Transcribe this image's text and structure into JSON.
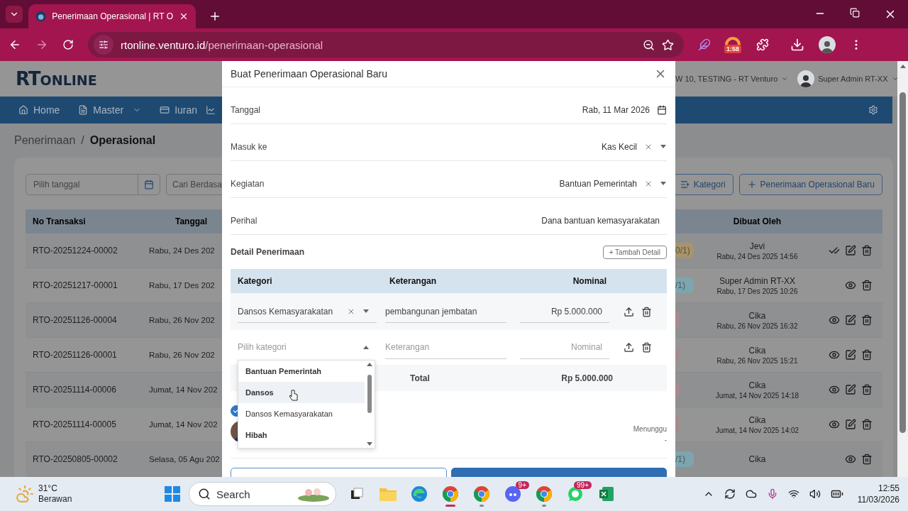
{
  "browser": {
    "tab_title": "Penerimaan Operasional | RT O",
    "url_host": "rtonline.venturo.id",
    "url_path": "/penerimaan-operasional",
    "extension_badge": "1:58"
  },
  "app": {
    "logo": {
      "first": "RT",
      "second": "ONLINE"
    },
    "org": "W 10, TESTING - RT Venturo",
    "user": "Super Admin RT-XX",
    "nav": [
      {
        "label": "Home",
        "kind": "home",
        "dropdown": false
      },
      {
        "label": "Master",
        "kind": "file",
        "dropdown": true
      },
      {
        "label": "Iuran",
        "kind": "card",
        "dropdown": false
      }
    ],
    "breadcrumb": {
      "parent": "Penerimaan",
      "separator": "/",
      "current": "Operasional"
    },
    "filters": {
      "date_placeholder": "Pilih tanggal",
      "search_placeholder": "Cari Berdasa"
    },
    "buttons": [
      {
        "label": "Kategori",
        "kind": "list"
      },
      {
        "label": "Penerimaan Operasional Baru",
        "kind": "plus"
      }
    ],
    "table": {
      "columns": [
        "No Transaksi",
        "Tanggal",
        "Dibuat Oleh"
      ],
      "rows": [
        {
          "no": "RTO-20251224-00002",
          "date": "Rabu, 24 Des 202",
          "badge": "0/1)",
          "color": "#a8946c",
          "by": "Jevi",
          "by_date": "Rabu, 24 Des 2025 14:56",
          "actions": [
            {
              "kind": "approve"
            },
            {
              "kind": "edit"
            },
            {
              "kind": "delete"
            }
          ]
        },
        {
          "no": "RTO-20251217-00001",
          "date": "Rabu, 17 Des 202",
          "badge": "/1)",
          "color": "#7ea5ae",
          "by": "Super Admin RT-XX",
          "by_date": "Rabu, 17 Des 2025 10:26",
          "actions": [
            {
              "kind": "view"
            },
            {
              "kind": "delete"
            }
          ]
        },
        {
          "no": "RTO-20251126-00004",
          "date": "Rabu, 26 Nov 202",
          "color": "#a88a8c",
          "by": "Cika",
          "by_date": "Rabu, 26 Nov 2025 16:32",
          "actions": [
            {
              "kind": "view"
            },
            {
              "kind": "edit"
            },
            {
              "kind": "delete"
            }
          ]
        },
        {
          "no": "RTO-20251126-00001",
          "date": "Rabu, 26 Nov 202",
          "color": "#a88a8c",
          "by": "Cika",
          "by_date": "Rabu, 26 Nov 2025 15:21",
          "actions": [
            {
              "kind": "view"
            },
            {
              "kind": "edit"
            },
            {
              "kind": "delete"
            }
          ]
        },
        {
          "no": "RTO-20251114-00006",
          "date": "Jumat, 14 Nov 202",
          "color": "#a88a8c",
          "by": "Cika",
          "by_date": "Jumat, 14 Nov 2025 14:18",
          "actions": [
            {
              "kind": "view"
            },
            {
              "kind": "edit"
            },
            {
              "kind": "delete"
            }
          ]
        },
        {
          "no": "RTO-20251114-00005",
          "date": "Jumat, 14 Nov 202",
          "color": "#a88a8c",
          "by": "Cika",
          "by_date": "Jumat, 14 Nov 2025 14:02",
          "actions": [
            {
              "kind": "view"
            },
            {
              "kind": "edit"
            },
            {
              "kind": "delete"
            }
          ]
        },
        {
          "no": "RTO-20250805-00002",
          "date": "Selasa, 05 Agu 202",
          "badge": "/1)",
          "color": "#7ea5ae",
          "by": "Cika",
          "actions": [
            {
              "kind": "view"
            },
            {
              "kind": "delete"
            }
          ]
        }
      ]
    }
  },
  "modal": {
    "title": "Buat Penerimaan Operasional Baru",
    "fields": [
      {
        "label": "Tanggal",
        "value": "Rab, 11 Mar 2026",
        "kind": "date"
      },
      {
        "label": "Masuk ke",
        "value": "Kas Kecil",
        "kind": "select"
      },
      {
        "label": "Kegiatan",
        "value": "Bantuan Pemerintah",
        "kind": "select"
      },
      {
        "label": "Perihal",
        "value": "Dana bantuan kemasyarakatan",
        "kind": "text"
      }
    ],
    "detail_title": "Detail Penerimaan",
    "add_button": "+ Tambah Detail",
    "columns": [
      "Kategori",
      "Keterangan",
      "Nominal"
    ],
    "rows": [
      {
        "kategori": "Dansos Kemasyarakatan",
        "keterangan": "pembangunan jembatan",
        "nominal": "Rp 5.000.000",
        "open": false
      },
      {
        "kategori_placeholder": "Pilih kategori",
        "keterangan_placeholder": "Keterangan",
        "nominal_placeholder": "Nominal",
        "open": true
      }
    ],
    "total_label": "Total",
    "total": "Rp 5.000.000",
    "options": [
      {
        "label": "Bantuan Pemerintah",
        "kind": "group",
        "highlighted": false
      },
      {
        "label": "Dansos",
        "kind": "group",
        "highlighted": true
      },
      {
        "label": "Dansos Kemasyarakatan",
        "kind": "item",
        "highlighted": false
      },
      {
        "label": "Hibah",
        "kind": "group",
        "highlighted": false
      }
    ],
    "approval": {
      "checked": true,
      "status": "Menunggu",
      "note": "-"
    },
    "footer_buttons": [
      {
        "kind": "outline"
      },
      {
        "kind": "primary"
      }
    ]
  },
  "taskbar": {
    "weather": {
      "temp": "31°C",
      "desc": "Berawan"
    },
    "search": "Search",
    "apps": [
      {
        "kind": "taskview"
      },
      {
        "kind": "folder"
      },
      {
        "kind": "edge"
      },
      {
        "kind": "chrome",
        "active": true
      },
      {
        "kind": "chrome",
        "active": false
      },
      {
        "kind": "discord",
        "badge": "9+"
      },
      {
        "kind": "chrome",
        "active": false
      },
      {
        "kind": "whatsapp",
        "badge": "99+"
      },
      {
        "kind": "excel"
      }
    ],
    "clock": {
      "time": "12:55",
      "date": "11/03/2026"
    }
  }
}
